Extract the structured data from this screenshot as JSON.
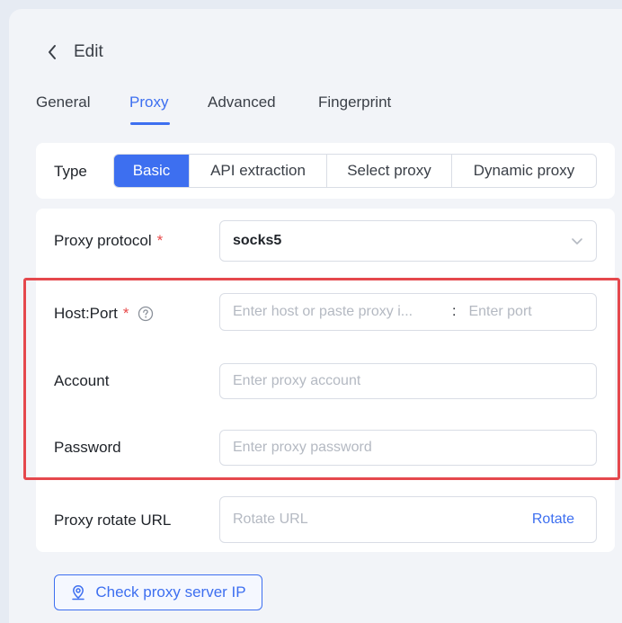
{
  "header": {
    "title": "Edit",
    "back_icon": "chevron-left-icon"
  },
  "tabs": [
    {
      "label": "General",
      "active": false
    },
    {
      "label": "Proxy",
      "active": true
    },
    {
      "label": "Advanced",
      "active": false
    },
    {
      "label": "Fingerprint",
      "active": false
    }
  ],
  "type": {
    "label": "Type",
    "options": [
      "Basic",
      "API extraction",
      "Select proxy",
      "Dynamic proxy"
    ],
    "selected": "Basic"
  },
  "fields": {
    "protocol": {
      "label": "Proxy protocol",
      "required_mark": "*",
      "value": "socks5",
      "icon": "chevron-down-icon"
    },
    "hostport": {
      "label": "Host:Port",
      "required_mark": "*",
      "help_icon": "question-circle-icon",
      "host_placeholder": "Enter host or paste proxy i...",
      "separator": ":",
      "port_placeholder": "Enter port"
    },
    "account": {
      "label": "Account",
      "placeholder": "Enter proxy account"
    },
    "password": {
      "label": "Password",
      "placeholder": "Enter proxy password"
    },
    "rotate": {
      "label": "Proxy rotate URL",
      "placeholder": "Rotate URL",
      "button": "Rotate"
    }
  },
  "check_button": {
    "label": "Check proxy server IP",
    "icon": "location-pin-icon"
  },
  "colors": {
    "accent": "#3d6ff0",
    "highlight": "#e5484d",
    "required": "#e84a4a"
  }
}
